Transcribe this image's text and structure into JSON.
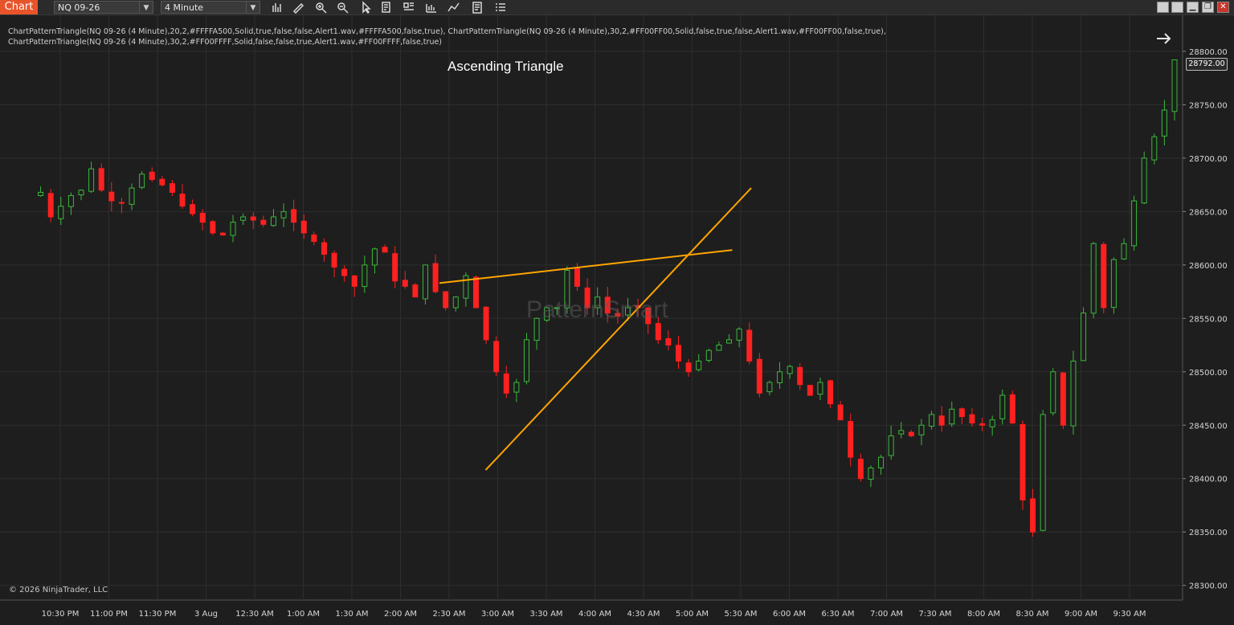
{
  "toolbar": {
    "chart_tab": "Chart",
    "instrument": "NQ 09-26",
    "interval": "4 Minute",
    "icons": [
      "bar-type-icon",
      "draw-pencil-icon",
      "zoom-in-icon",
      "zoom-out-icon",
      "pointer-icon",
      "data-box-icon",
      "templates-icon",
      "chart-trader-icon",
      "strategy-icon",
      "properties-icon",
      "indicators-list-icon"
    ],
    "window_buttons": [
      "restore-icon",
      "restore-icon",
      "minimize-icon",
      "maximize-icon",
      "close-icon"
    ]
  },
  "chart": {
    "indicator_text": "ChartPatternTriangle(NQ 09-26 (4 Minute),20,2,#FFFFA500,Solid,true,false,false,Alert1.wav,#FFFFA500,false,true), ChartPatternTriangle(NQ 09-26 (4 Minute),30,2,#FF00FF00,Solid,false,true,false,Alert1.wav,#FF00FF00,false,true), ChartPatternTriangle(NQ 09-26 (4 Minute),30,2,#FF00FFFF,Solid,false,false,true,Alert1.wav,#FF00FFFF,false,true)",
    "pattern_label": "Ascending Triangle",
    "watermark": "PatternSmart",
    "copyright": "© 2026 NinjaTrader, LLC",
    "last_price": "28792.00",
    "colors": {
      "up": "#3cb83c",
      "down": "#ff2020",
      "triangle": "#ffa500",
      "grid": "#2e2e2e",
      "background": "#1e1e1e"
    }
  },
  "chart_data": {
    "type": "candlestick",
    "y_ticks": [
      "28800.00",
      "28750.00",
      "28700.00",
      "28650.00",
      "28600.00",
      "28550.00",
      "28500.00",
      "28450.00",
      "28400.00",
      "28350.00",
      "28300.00"
    ],
    "ylim": [
      28290,
      28830
    ],
    "x_ticks": [
      "10:30 PM",
      "11:00 PM",
      "11:30 PM",
      "3 Aug",
      "12:30 AM",
      "1:00 AM",
      "1:30 AM",
      "2:00 AM",
      "2:30 AM",
      "3:00 AM",
      "3:30 AM",
      "4:00 AM",
      "4:30 AM",
      "5:00 AM",
      "5:30 AM",
      "6:00 AM",
      "6:30 AM",
      "7:00 AM",
      "7:30 AM",
      "8:00 AM",
      "8:30 AM",
      "9:00 AM",
      "9:30 AM"
    ],
    "close_path": [
      28665,
      28668,
      28645,
      28655,
      28665,
      28670,
      28690,
      28670,
      28660,
      28658,
      28672,
      28685,
      28680,
      28675,
      28668,
      28655,
      28648,
      28640,
      28630,
      28628,
      28640,
      28645,
      28642,
      28638,
      28645,
      28650,
      28640,
      28630,
      28622,
      28610,
      28598,
      28590,
      28580,
      28600,
      28615,
      28612,
      28585,
      28580,
      28570,
      28600,
      28575,
      28560,
      28570,
      28590,
      28560,
      28530,
      28500,
      28480,
      28490,
      28530,
      28550,
      28560,
      28560,
      28595,
      28580,
      28560,
      28570,
      28555,
      28552,
      28560,
      28560,
      28545,
      28530,
      28525,
      28510,
      28500,
      28510,
      28520,
      28525,
      28530,
      28540,
      28510,
      28480,
      28490,
      28500,
      28505,
      28488,
      28478,
      28490,
      28470,
      28455,
      28420,
      28400,
      28410,
      28420,
      28440,
      28445,
      28440,
      28450,
      28460,
      28450,
      28465,
      28458,
      28452,
      28450,
      28455,
      28478,
      28452,
      28380,
      28350,
      28460,
      28500,
      28450,
      28510,
      28555,
      28620,
      28560,
      28605,
      28620,
      28660,
      28700,
      28720,
      28745,
      28792
    ],
    "triangle_lines": [
      {
        "name": "resistance",
        "from": [
          28583,
          "2:30 AM"
        ],
        "to": [
          28614,
          "5:20 AM"
        ]
      },
      {
        "name": "support",
        "from": [
          28408,
          "2:50 AM"
        ],
        "to": [
          28672,
          "5:35 AM"
        ]
      }
    ]
  }
}
